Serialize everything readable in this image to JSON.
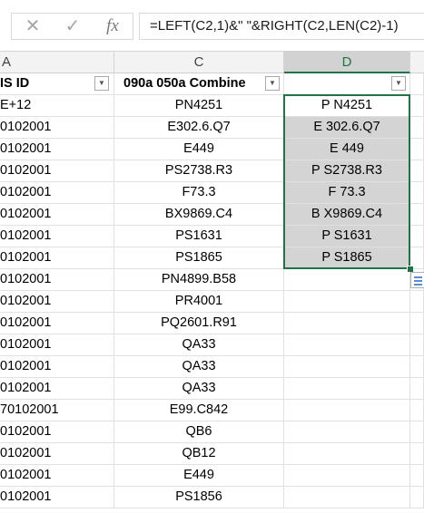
{
  "formula_bar": {
    "cancel_icon": "✕",
    "enter_icon": "✓",
    "fx_label": "fx",
    "formula": "=LEFT(C2,1)&\" \"&RIGHT(C2,LEN(C2)-1)"
  },
  "column_headers": [
    "A",
    "C",
    "D"
  ],
  "selected_column": "D",
  "header_row": {
    "A": "IS ID",
    "C": "090a  050a Combine",
    "D": ""
  },
  "rows": [
    {
      "A": "E+12",
      "C": "PN4251",
      "D": "P N4251"
    },
    {
      "A": "0102001",
      "C": "E302.6.Q7",
      "D": "E 302.6.Q7"
    },
    {
      "A": "0102001",
      "C": "E449",
      "D": "E 449"
    },
    {
      "A": "0102001",
      "C": "PS2738.R3",
      "D": "P S2738.R3"
    },
    {
      "A": "0102001",
      "C": "F73.3",
      "D": "F 73.3"
    },
    {
      "A": "0102001",
      "C": "BX9869.C4",
      "D": "B X9869.C4"
    },
    {
      "A": "0102001",
      "C": "PS1631",
      "D": "P S1631"
    },
    {
      "A": "0102001",
      "C": "PS1865",
      "D": "P S1865"
    },
    {
      "A": "0102001",
      "C": "PN4899.B58",
      "D": ""
    },
    {
      "A": "0102001",
      "C": "PR4001",
      "D": ""
    },
    {
      "A": "0102001",
      "C": "PQ2601.R91",
      "D": ""
    },
    {
      "A": "0102001",
      "C": "QA33",
      "D": ""
    },
    {
      "A": "0102001",
      "C": "QA33",
      "D": ""
    },
    {
      "A": "0102001",
      "C": "QA33",
      "D": ""
    },
    {
      "A": "70102001",
      "C": "E99.C842",
      "D": ""
    },
    {
      "A": "0102001",
      "C": "QB6",
      "D": ""
    },
    {
      "A": "0102001",
      "C": "QB12",
      "D": ""
    },
    {
      "A": "0102001",
      "C": "E449",
      "D": ""
    },
    {
      "A": "0102001",
      "C": "PS1856",
      "D": ""
    }
  ],
  "filter_icon": "▼",
  "colors": {
    "accent": "#217346",
    "selection": "#d4d4d4"
  }
}
